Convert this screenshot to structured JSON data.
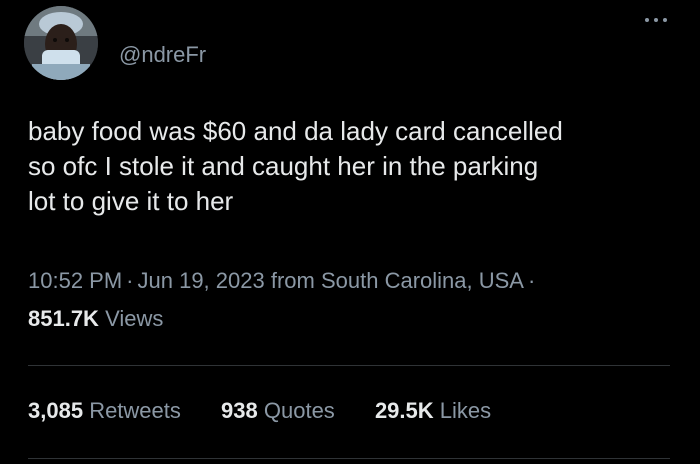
{
  "author": {
    "handle": "@ndreFr",
    "avatar_icon": "profile-photo-avatar"
  },
  "more_icon": "more-horizontal-icon",
  "tweet": {
    "text_lines": [
      "baby food was $60 and da lady card cancelled",
      "so ofc I stole it and caught her in the parking",
      "lot to give it to her"
    ],
    "time": "10:52 PM",
    "date": "Jun 19, 2023",
    "location": "from South Carolina, USA",
    "separator": "·",
    "views_count": "851.7K",
    "views_label": "Views"
  },
  "stats": {
    "retweets_count": "3,085",
    "retweets_label": "Retweets",
    "quotes_count": "938",
    "quotes_label": "Quotes",
    "likes_count": "29.5K",
    "likes_label": "Likes"
  },
  "colors": {
    "background": "#000000",
    "primary_text": "#e7e9ea",
    "secondary_text": "#8b98a5",
    "divider": "#2f3336"
  }
}
